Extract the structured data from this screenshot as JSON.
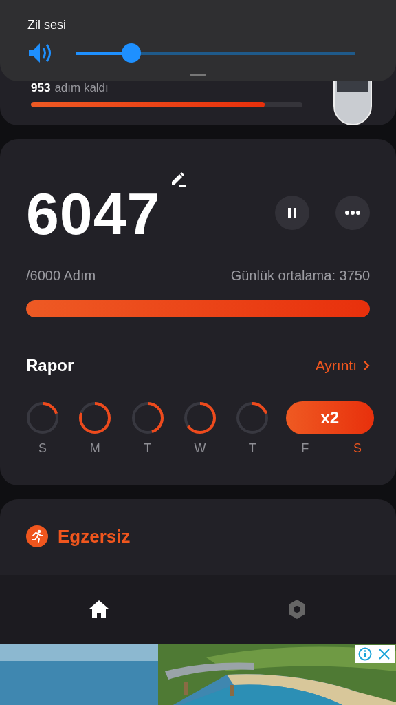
{
  "volume_panel": {
    "title": "Zil sesi",
    "level": 0.2
  },
  "goal_card": {
    "remaining_count": "953",
    "remaining_label": "adım kaldı",
    "level": 0.86
  },
  "steps_card": {
    "count": "6047",
    "goal": "/6000 Adım",
    "average": "Günlük ortalama: 3750",
    "level": 1,
    "report_title": "Rapor",
    "details_link": "Ayrıntı",
    "streak": "x2",
    "days": [
      {
        "label": "S",
        "selected": false
      },
      {
        "label": "M",
        "selected": false
      },
      {
        "label": "T",
        "selected": false
      },
      {
        "label": "W",
        "selected": false
      },
      {
        "label": "T",
        "selected": false
      },
      {
        "label": "F",
        "selected": false
      },
      {
        "label": "S",
        "selected": true
      }
    ]
  },
  "exercise_card": {
    "title": "Egzersiz"
  },
  "nav": [
    {
      "kind": "home",
      "selected": true
    },
    {
      "kind": "settings",
      "selected": false
    }
  ]
}
